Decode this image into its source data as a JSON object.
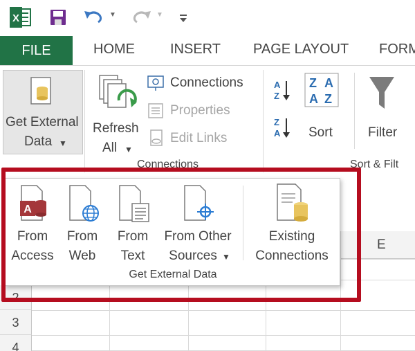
{
  "quick_access": {
    "app_icon": "excel-icon",
    "save_icon": "save-icon",
    "undo_icon": "undo-icon",
    "redo_icon": "redo-icon",
    "customize_icon": "customize-icon"
  },
  "tabs": {
    "file": "FILE",
    "home": "HOME",
    "insert": "INSERT",
    "page_layout": "PAGE LAYOUT",
    "formulas": "FORM"
  },
  "ribbon": {
    "get_external_data_line1": "Get External",
    "get_external_data_line2": "Data",
    "refresh_all_line1": "Refresh",
    "refresh_all_line2": "All",
    "connections": "Connections",
    "properties": "Properties",
    "edit_links": "Edit Links",
    "connections_group": "Connections",
    "sort": "Sort",
    "filter": "Filter",
    "sort_filter_group": "Sort & Filt"
  },
  "dropdown": {
    "from_access_line1": "From",
    "from_access_line2": "Access",
    "from_web_line1": "From",
    "from_web_line2": "Web",
    "from_text_line1": "From",
    "from_text_line2": "Text",
    "from_other_line1": "From Other",
    "from_other_line2": "Sources",
    "existing_line1": "Existing",
    "existing_line2": "Connections",
    "group_label": "Get External Data"
  },
  "grid": {
    "column_e": "E",
    "rows": [
      "2",
      "3",
      "4"
    ]
  },
  "colors": {
    "excel_green": "#217346",
    "highlight_red": "#b50d1f",
    "access_red": "#a4373a",
    "web_blue": "#2b7cd3",
    "cylinder_gold": "#e8c45e"
  }
}
